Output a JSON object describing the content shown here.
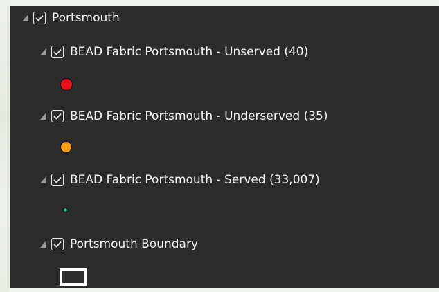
{
  "layers": {
    "group": {
      "label": "Portsmouth",
      "checked": true
    },
    "items": [
      {
        "label": "BEAD Fabric Portsmouth - Unserved (40)",
        "checked": true,
        "symbol": "point",
        "color": "#e8101a"
      },
      {
        "label": "BEAD Fabric Portsmouth - Underserved (35)",
        "checked": true,
        "symbol": "point",
        "color": "#f5a21a"
      },
      {
        "label": "BEAD Fabric Portsmouth - Served (33,007)",
        "checked": true,
        "symbol": "point",
        "color": "#2ea38a"
      },
      {
        "label": "Portsmouth Boundary",
        "checked": true,
        "symbol": "polygon-outline",
        "color": "#ffffff"
      }
    ]
  },
  "icons": [
    "expand-triangle-icon",
    "checkbox-checked-icon",
    "point-symbol-icon",
    "polygon-symbol-icon"
  ]
}
